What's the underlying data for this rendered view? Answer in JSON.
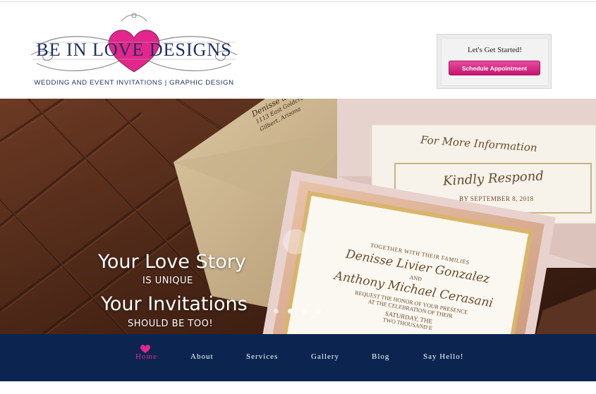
{
  "brand": {
    "name": "BE IN LOVE DESIGNS",
    "tagline": "WEDDING AND EVENT INVITATIONS  |  GRAPHIC DESIGN",
    "colors": {
      "navy": "#0c2550",
      "pink": "#e2268b"
    }
  },
  "cta": {
    "title": "Let's Get Started!",
    "button_label": "Schedule Appointment"
  },
  "hero": {
    "line1": "Your Love Story",
    "line2": "IS UNIQUE",
    "line3": "Your Invitations",
    "line4": "SHOULD BE TOO!",
    "slides": 4,
    "active_slide": 2,
    "envelope_text": {
      "return_addr": [
        "Denisse and",
        "1113 East Goldcrest",
        "Gilbert, Arizona"
      ],
      "card_info": "For More Information",
      "card_rsvp": "Kindly Respond",
      "rsvp_date": "BY SEPTEMBER 8, 2018",
      "inv_line1": "TOGETHER WITH THEIR FAMILIES",
      "inv_bride": "Denisse Livier Gonzalez",
      "inv_and": "AND",
      "inv_groom": "Anthony Michael Cerasani",
      "inv_line2": "REQUEST THE HONOR OF YOUR PRESENCE",
      "inv_line3": "AT THE CELEBRATION OF THEIR",
      "inv_line4": "SATURDAY, THE",
      "inv_line5": "TWO THOUSAND E"
    }
  },
  "nav": {
    "items": [
      {
        "label": "Home",
        "active": true
      },
      {
        "label": "About"
      },
      {
        "label": "Services"
      },
      {
        "label": "Gallery"
      },
      {
        "label": "Blog"
      },
      {
        "label": "Say Hello!"
      }
    ],
    "home_icon": "heart-icon"
  }
}
